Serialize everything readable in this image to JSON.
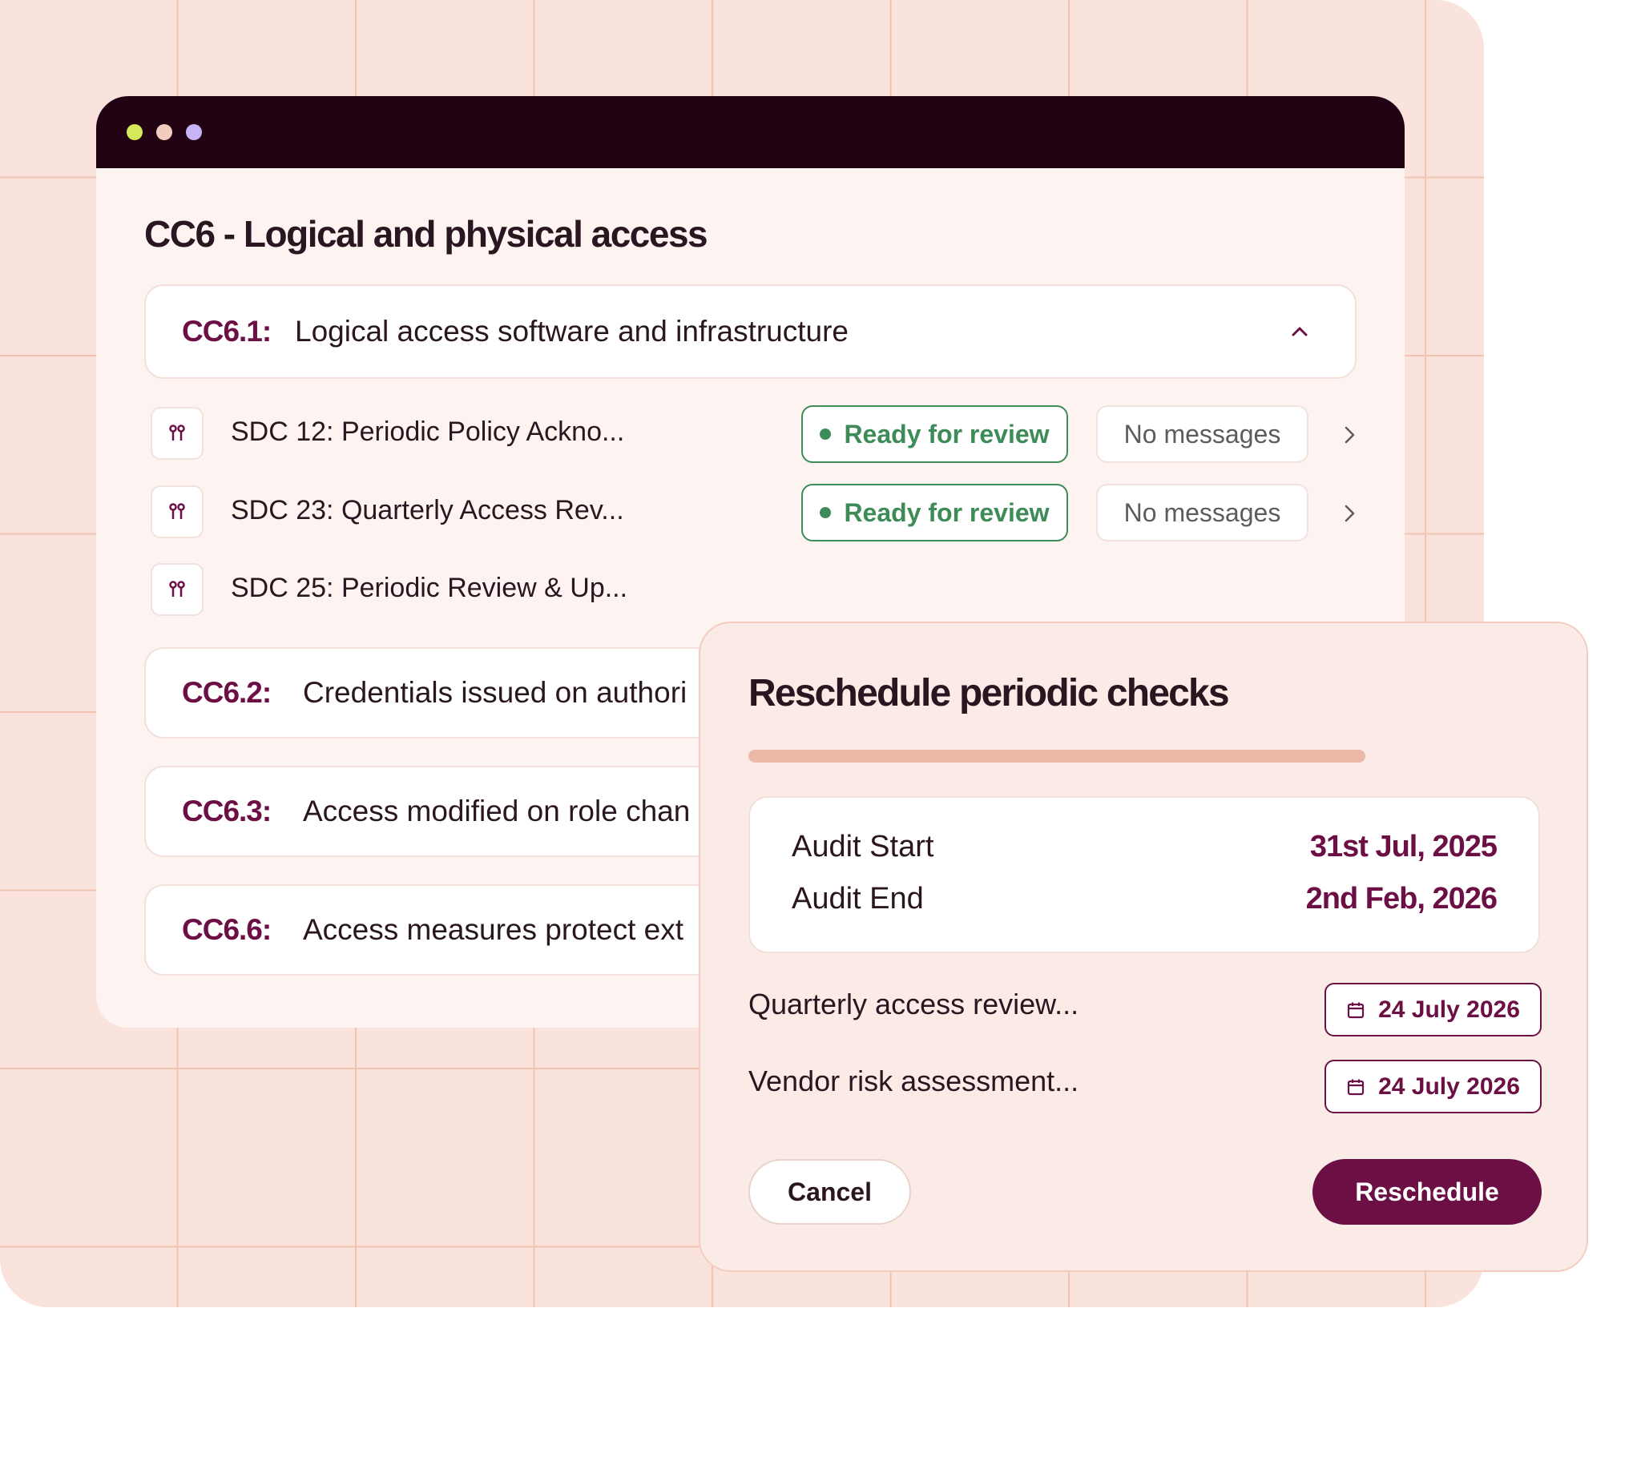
{
  "window": {
    "dots": [
      "#d4e85a",
      "#f2cdbf",
      "#c7b3f5"
    ],
    "title": "CC6 - Logical and physical access"
  },
  "sections": [
    {
      "code": "CC6.1:",
      "label": "Logical access software and infrastructure",
      "expanded": true
    },
    {
      "code": "CC6.2:",
      "label": "Credentials issued on authori"
    },
    {
      "code": "CC6.3:",
      "label": "Access modified on role chan"
    },
    {
      "code": "CC6.6:",
      "label": "Access measures protect ext"
    }
  ],
  "items": [
    {
      "label": "SDC 12: Periodic Policy Ackno...",
      "status": "Ready for review",
      "messages": "No messages"
    },
    {
      "label": "SDC 23: Quarterly Access Rev...",
      "status": "Ready for review",
      "messages": "No messages"
    },
    {
      "label": "SDC 25: Periodic Review & Up..."
    }
  ],
  "modal": {
    "title": "Reschedule periodic checks",
    "progress_percent": 100,
    "audit_start_label": "Audit Start",
    "audit_start_value": "31st Jul, 2025",
    "audit_end_label": "Audit End",
    "audit_end_value": "2nd Feb, 2026",
    "checks": [
      {
        "label": "Quarterly access review...",
        "date": "24 July 2026"
      },
      {
        "label": "Vendor risk assessment...",
        "date": "24 July 2026"
      }
    ],
    "cancel_label": "Cancel",
    "reschedule_label": "Reschedule"
  },
  "colors": {
    "accent": "#6b0f45",
    "status_green": "#3d8b57",
    "titlebar": "#210314",
    "background": "#fae3dc"
  }
}
